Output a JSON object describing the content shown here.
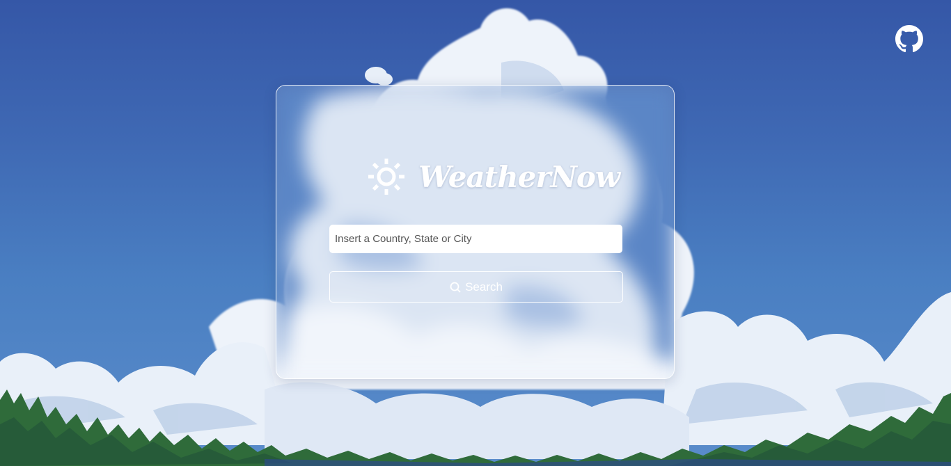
{
  "app": {
    "brand_name": "WeatherNow",
    "brand_icon": "sun-icon"
  },
  "header": {
    "github_icon": "github-icon"
  },
  "search": {
    "placeholder": "Insert a Country, State or City",
    "value": "",
    "button_label": "Search",
    "button_icon": "search-icon"
  },
  "colors": {
    "sky_top": "#3557a7",
    "sky_bottom": "#5a8ccb",
    "text": "#ffffff",
    "forest": "#2f6b3a"
  }
}
